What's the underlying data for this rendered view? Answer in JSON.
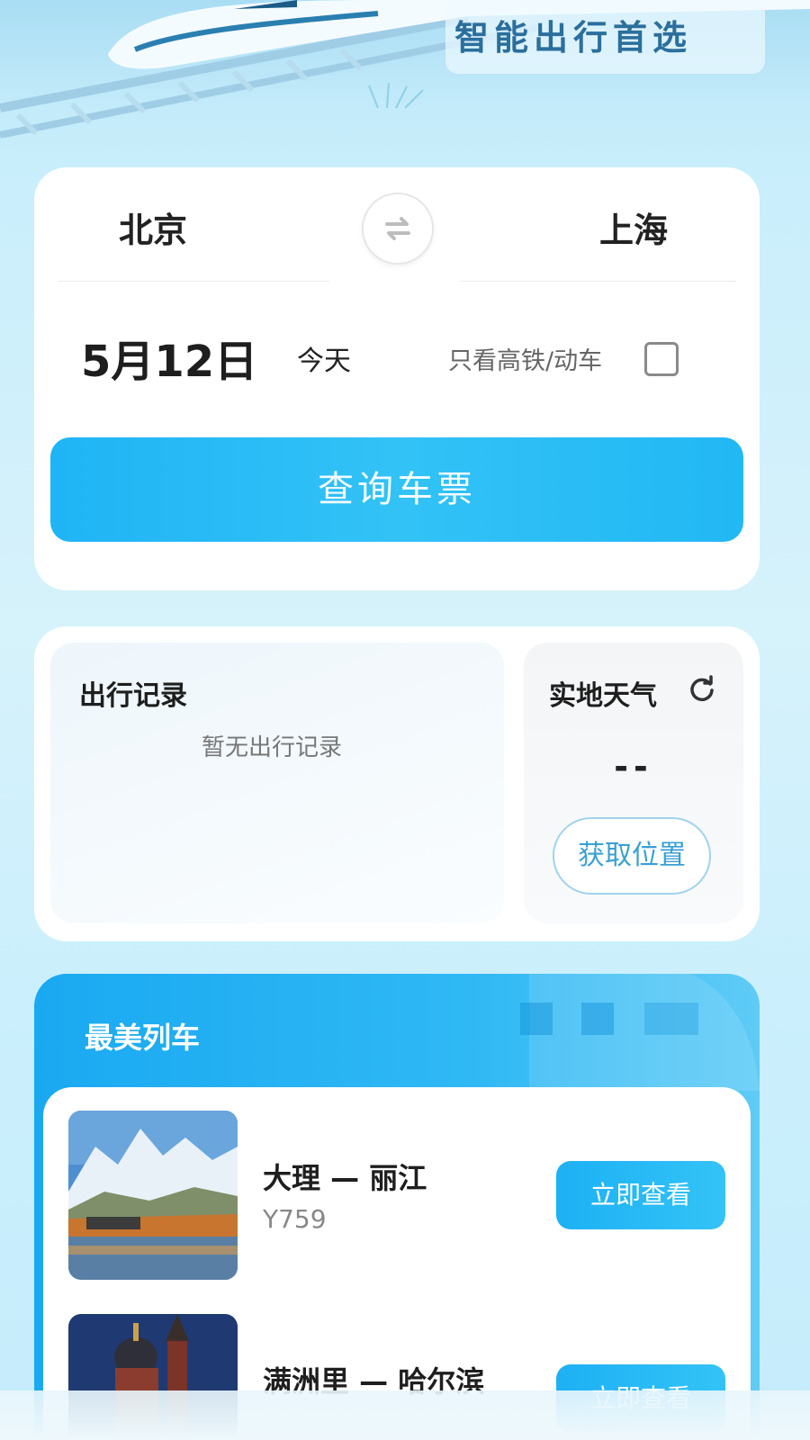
{
  "header": {
    "slogan": "智能出行首选"
  },
  "search": {
    "from_city": "北京",
    "to_city": "上海",
    "date": "5月12日",
    "day_label": "今天",
    "hsr_only_label": "只看高铁/动车",
    "hsr_only_checked": false,
    "query_button": "查询车票",
    "swap_icon": "swap-arrows-icon"
  },
  "travel_record": {
    "title": "出行记录",
    "empty_text": "暂无出行记录"
  },
  "weather": {
    "title": "实地天气",
    "value": "--",
    "refresh_icon": "refresh-icon",
    "location_button": "获取位置"
  },
  "beautiful_trains": {
    "title": "最美列车",
    "items": [
      {
        "route": "大理 — 丽江",
        "train_no": "Y759",
        "button": "立即查看",
        "image": "snow-mountain-lake-photo"
      },
      {
        "route": "满洲里 — 哈尔滨",
        "train_no": "",
        "button": "立即查看",
        "image": "onion-dome-church-photo"
      }
    ]
  },
  "colors": {
    "accent": "#1fb4f5",
    "location_text": "#3a9fd4",
    "background": "#c9eefb"
  }
}
